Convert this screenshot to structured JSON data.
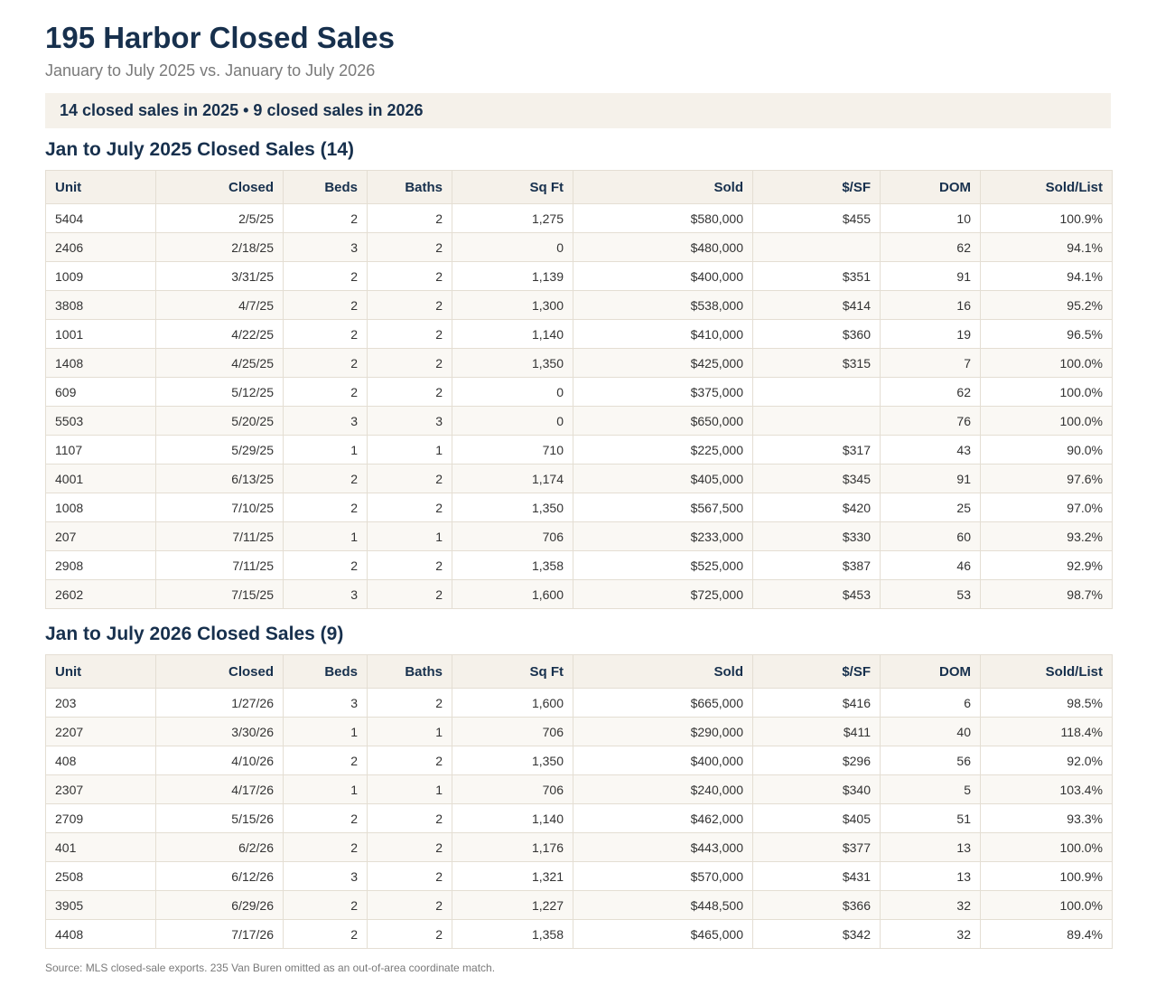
{
  "title": "195 Harbor Closed Sales",
  "subtitle": "January to July 2025 vs. January to July 2026",
  "summary": "14 closed sales in 2025 • 9 closed sales in 2026",
  "columns": [
    "Unit",
    "Closed",
    "Beds",
    "Baths",
    "Sq Ft",
    "Sold",
    "$/SF",
    "DOM",
    "Sold/List"
  ],
  "tables": [
    {
      "heading": "Jan to July 2025 Closed Sales (14)",
      "rows": [
        [
          "5404",
          "2/5/25",
          "2",
          "2",
          "1,275",
          "$580,000",
          "$455",
          "10",
          "100.9%"
        ],
        [
          "2406",
          "2/18/25",
          "3",
          "2",
          "0",
          "$480,000",
          "",
          "62",
          "94.1%"
        ],
        [
          "1009",
          "3/31/25",
          "2",
          "2",
          "1,139",
          "$400,000",
          "$351",
          "91",
          "94.1%"
        ],
        [
          "3808",
          "4/7/25",
          "2",
          "2",
          "1,300",
          "$538,000",
          "$414",
          "16",
          "95.2%"
        ],
        [
          "1001",
          "4/22/25",
          "2",
          "2",
          "1,140",
          "$410,000",
          "$360",
          "19",
          "96.5%"
        ],
        [
          "1408",
          "4/25/25",
          "2",
          "2",
          "1,350",
          "$425,000",
          "$315",
          "7",
          "100.0%"
        ],
        [
          "609",
          "5/12/25",
          "2",
          "2",
          "0",
          "$375,000",
          "",
          "62",
          "100.0%"
        ],
        [
          "5503",
          "5/20/25",
          "3",
          "3",
          "0",
          "$650,000",
          "",
          "76",
          "100.0%"
        ],
        [
          "1107",
          "5/29/25",
          "1",
          "1",
          "710",
          "$225,000",
          "$317",
          "43",
          "90.0%"
        ],
        [
          "4001",
          "6/13/25",
          "2",
          "2",
          "1,174",
          "$405,000",
          "$345",
          "91",
          "97.6%"
        ],
        [
          "1008",
          "7/10/25",
          "2",
          "2",
          "1,350",
          "$567,500",
          "$420",
          "25",
          "97.0%"
        ],
        [
          "207",
          "7/11/25",
          "1",
          "1",
          "706",
          "$233,000",
          "$330",
          "60",
          "93.2%"
        ],
        [
          "2908",
          "7/11/25",
          "2",
          "2",
          "1,358",
          "$525,000",
          "$387",
          "46",
          "92.9%"
        ],
        [
          "2602",
          "7/15/25",
          "3",
          "2",
          "1,600",
          "$725,000",
          "$453",
          "53",
          "98.7%"
        ]
      ]
    },
    {
      "heading": "Jan to July 2026 Closed Sales (9)",
      "rows": [
        [
          "203",
          "1/27/26",
          "3",
          "2",
          "1,600",
          "$665,000",
          "$416",
          "6",
          "98.5%"
        ],
        [
          "2207",
          "3/30/26",
          "1",
          "1",
          "706",
          "$290,000",
          "$411",
          "40",
          "118.4%"
        ],
        [
          "408",
          "4/10/26",
          "2",
          "2",
          "1,350",
          "$400,000",
          "$296",
          "56",
          "92.0%"
        ],
        [
          "2307",
          "4/17/26",
          "1",
          "1",
          "706",
          "$240,000",
          "$340",
          "5",
          "103.4%"
        ],
        [
          "2709",
          "5/15/26",
          "2",
          "2",
          "1,140",
          "$462,000",
          "$405",
          "51",
          "93.3%"
        ],
        [
          "401",
          "6/2/26",
          "2",
          "2",
          "1,176",
          "$443,000",
          "$377",
          "13",
          "100.0%"
        ],
        [
          "2508",
          "6/12/26",
          "3",
          "2",
          "1,321",
          "$570,000",
          "$431",
          "13",
          "100.9%"
        ],
        [
          "3905",
          "6/29/26",
          "2",
          "2",
          "1,227",
          "$448,500",
          "$366",
          "32",
          "100.0%"
        ],
        [
          "4408",
          "7/17/26",
          "2",
          "2",
          "1,358",
          "$465,000",
          "$342",
          "32",
          "89.4%"
        ]
      ]
    }
  ],
  "footer": "Source: MLS closed-sale exports. 235 Van Buren omitted as an out-of-area coordinate match."
}
